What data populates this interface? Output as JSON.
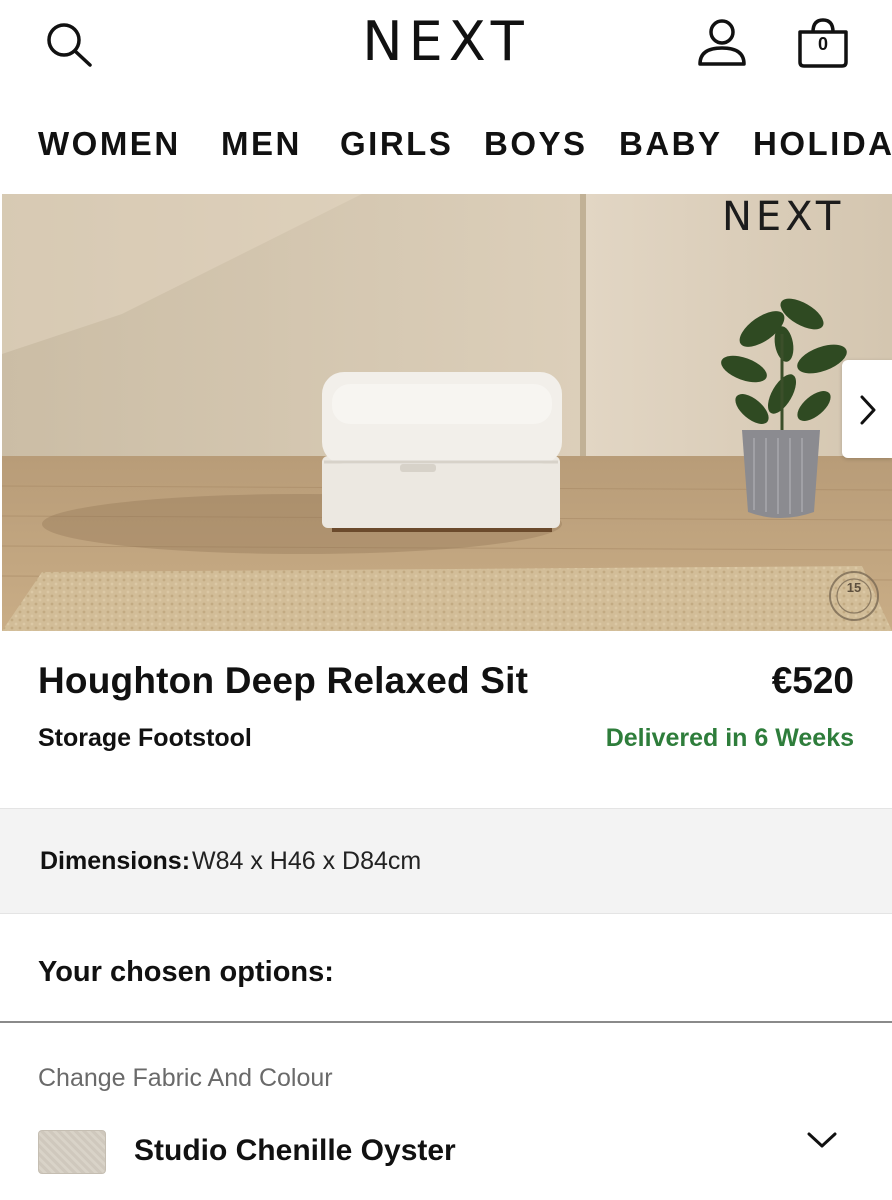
{
  "header": {
    "logo": "NEXT",
    "search_icon": "search-icon",
    "account_icon": "account-icon",
    "bag_icon": "shopping-bag-icon",
    "bag_count": "0"
  },
  "nav": {
    "items": [
      "WOMEN",
      "MEN",
      "GIRLS",
      "BOYS",
      "BABY",
      "HOLIDA"
    ]
  },
  "hero": {
    "watermark": "NEXT",
    "badge_text": "15",
    "next_icon": "chevron-right-icon"
  },
  "product": {
    "title": "Houghton Deep Relaxed Sit",
    "subtitle": "Storage Footstool",
    "price": "€520",
    "delivery": "Delivered in 6 Weeks"
  },
  "dimensions": {
    "label": "Dimensions:",
    "value": "W84 x H46 x D84cm"
  },
  "options": {
    "heading": "Your chosen options:",
    "fabric_label": "Change Fabric And Colour",
    "fabric_value": "Studio Chenille Oyster",
    "dropdown_icon": "chevron-down-icon"
  },
  "colors": {
    "delivery_green": "#2e7d3b",
    "dimensions_bg": "#f3f3f3",
    "text": "#111111"
  }
}
